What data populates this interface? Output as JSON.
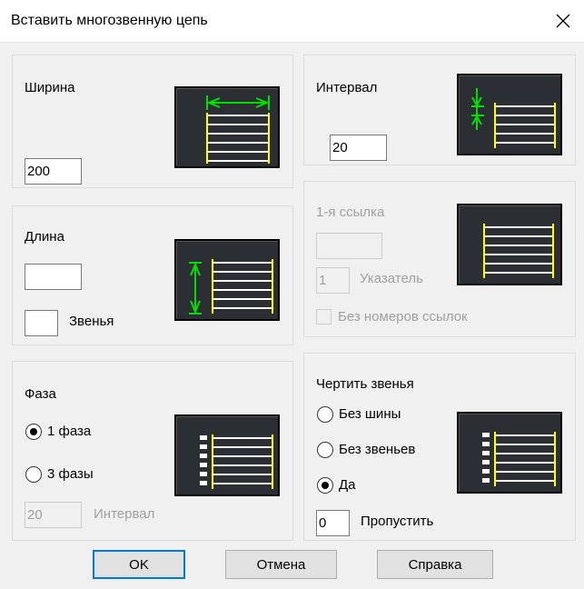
{
  "window": {
    "title": "Вставить многозвенную цепь"
  },
  "width_group": {
    "label": "Ширина",
    "value": "200"
  },
  "length_group": {
    "label": "Длина",
    "value": "",
    "links_label": "Звенья",
    "links_value": ""
  },
  "phase_group": {
    "label": "Фаза",
    "option_1": "1 фаза",
    "option_3": "3 фазы",
    "selected": "1 фаза",
    "interval_value": "20",
    "interval_label": "Интервал"
  },
  "interval_group": {
    "label": "Интервал",
    "value": "20"
  },
  "reference_group": {
    "label": "1-я ссылка",
    "value": "",
    "pointer_value": "1",
    "pointer_label": "Указатель",
    "no_ref_numbers_label": "Без номеров ссылок"
  },
  "draw_links_group": {
    "label": "Чертить звенья",
    "option_no_bus": "Без шины",
    "option_no_links": "Без звеньев",
    "option_yes": "Да",
    "selected": "Да",
    "skip_value": "0",
    "skip_label": "Пропустить"
  },
  "buttons": {
    "ok": "OK",
    "cancel": "Отмена",
    "help": "Справка"
  },
  "colors": {
    "wire": "#ffffff",
    "node": "#ffff00",
    "dimension": "#00e000",
    "preview_bg": "#2b2f33",
    "accent": "#0078d7"
  }
}
